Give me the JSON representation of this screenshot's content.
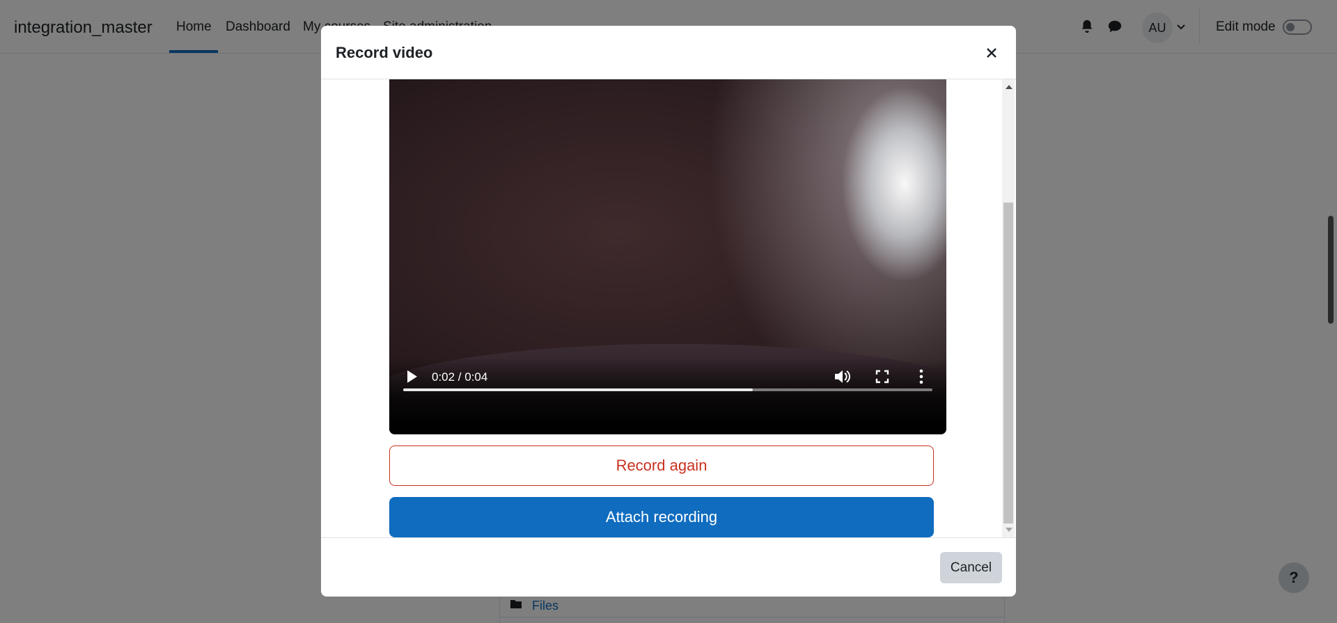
{
  "navbar": {
    "site_name": "integration_master",
    "links": [
      {
        "label": "Home",
        "active": true
      },
      {
        "label": "Dashboard",
        "active": false
      },
      {
        "label": "My courses",
        "active": false
      },
      {
        "label": "Site administration",
        "active": false
      }
    ],
    "user_initials": "AU",
    "edit_mode_label": "Edit mode",
    "edit_mode_on": false
  },
  "page": {
    "files_link": "Files",
    "help_label": "?"
  },
  "modal": {
    "title": "Record video",
    "close_label": "×",
    "video": {
      "time_text": "0:02 / 0:04",
      "progress_fraction": 0.66
    },
    "record_again_label": "Record again",
    "attach_label": "Attach recording",
    "cancel_label": "Cancel"
  },
  "colors": {
    "brand_blue": "#0f6cbf",
    "danger_red": "#ca3120",
    "secondary_grey": "#ced4da"
  },
  "icons": [
    "bell-icon",
    "chat-icon",
    "chevron-down-icon",
    "folder-icon",
    "close-icon",
    "play-icon",
    "volume-icon",
    "fullscreen-icon",
    "more-options-icon",
    "help-icon"
  ]
}
